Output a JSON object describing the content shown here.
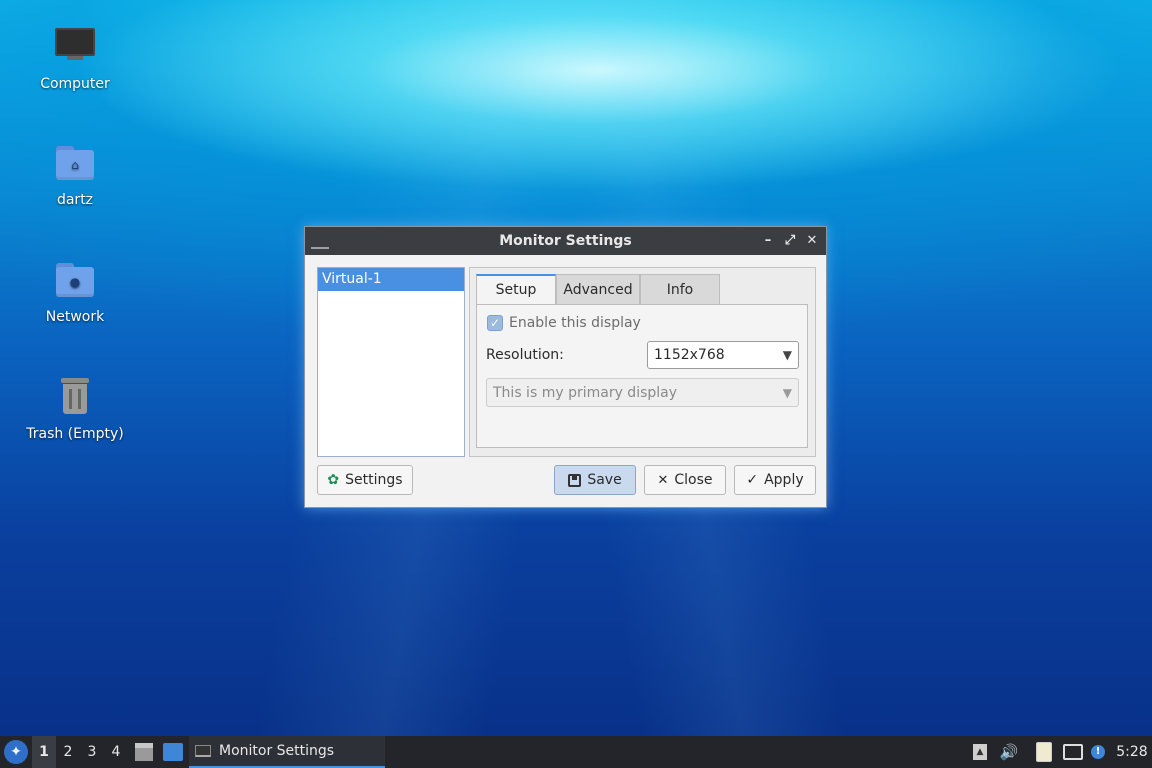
{
  "desktop": {
    "icons": [
      {
        "label": "Computer",
        "icon": "computer-icon"
      },
      {
        "label": "dartz",
        "icon": "home-folder-icon"
      },
      {
        "label": "Network",
        "icon": "network-folder-icon"
      },
      {
        "label": "Trash (Empty)",
        "icon": "trash-icon"
      }
    ]
  },
  "dialog": {
    "title": "Monitor Settings",
    "display_list": [
      "Virtual-1"
    ],
    "tabs": [
      "Setup",
      "Advanced",
      "Info"
    ],
    "active_tab": "Setup",
    "setup": {
      "enable_label": "Enable this display",
      "enable_checked": true,
      "resolution_label": "Resolution:",
      "resolution_value": "1152x768",
      "primary_value": "This is my primary display"
    },
    "buttons": {
      "settings": "Settings",
      "save": "Save",
      "close": "Close",
      "apply": "Apply"
    }
  },
  "taskbar": {
    "workspaces": [
      "1",
      "2",
      "3",
      "4"
    ],
    "active_workspace": "1",
    "task_label": "Monitor Settings",
    "clock": "5:28"
  },
  "colors": {
    "accent": "#4a90e2",
    "titlebar": "#3a3d42",
    "taskbar": "#23252a"
  }
}
